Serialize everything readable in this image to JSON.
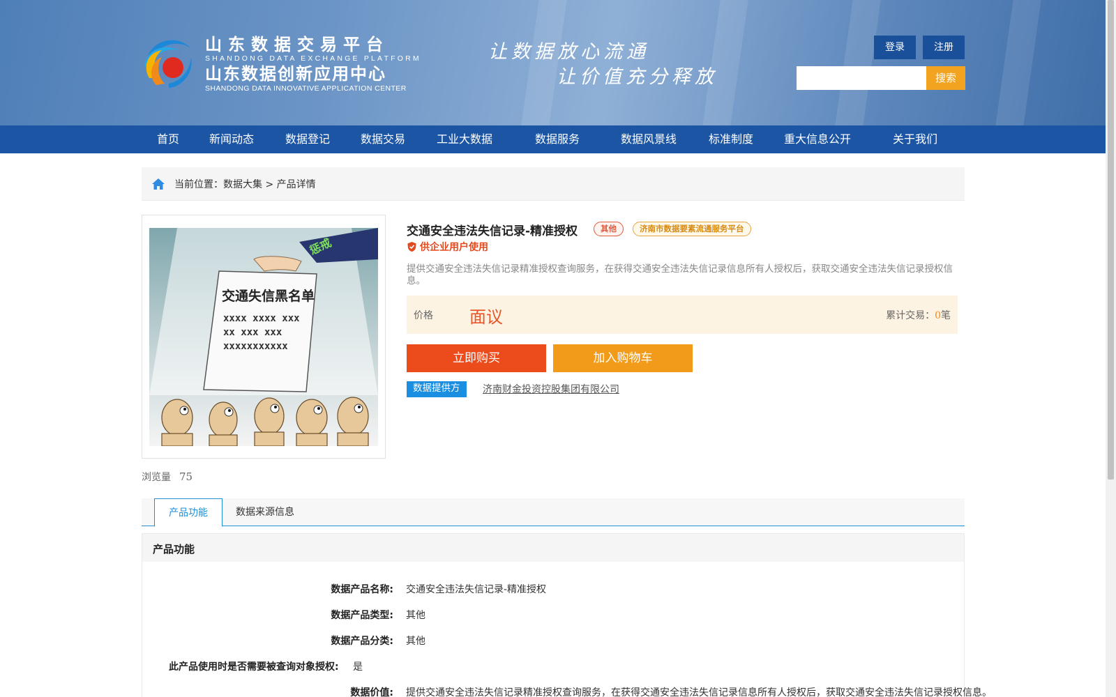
{
  "header": {
    "logo": {
      "cn_line1": "山东数据交易平台",
      "en_line1": "SHANDONG DATA EXCHANGE PLATFORM",
      "cn_line2": "山东数据创新应用中心",
      "en_line2": "SHANDONG DATA INNOVATIVE APPLICATION CENTER"
    },
    "slogan_line1": "让数据放心流通",
    "slogan_line2": "让价值充分释放",
    "login_label": "登录",
    "register_label": "注册",
    "search_placeholder": "",
    "search_label": "搜索"
  },
  "nav": {
    "items": [
      "首页",
      "新闻动态",
      "数据登记",
      "数据交易",
      "工业大数据",
      "数据服务",
      "数据风景线",
      "标准制度",
      "重大信息公开",
      "关于我们"
    ]
  },
  "breadcrumb": {
    "prefix": "当前位置：",
    "level1": "数据大集",
    "separator": " > ",
    "level2": "产品详情"
  },
  "product": {
    "image_text": {
      "sleeve_label": "惩戒",
      "paper_title": "交通失信黑名单",
      "paper_line1": "xxxx xxxx xxx",
      "paper_line2": "xx xxx xxx",
      "paper_line3": "xxxxxxxxxxx"
    },
    "views_label": "浏览量",
    "views_count": "75",
    "title": "交通安全违法失信记录-精准授权",
    "tag_category": "其他",
    "tag_platform": "济南市数据要素流通服务平台",
    "enterprise_label": "供企业用户使用",
    "description": "提供交通安全违法失信记录精准授权查询服务，在获得交通安全违法失信记录信息所有人授权后，获取交通安全违法失信记录授权信息。",
    "price_label": "价格",
    "price_value": "面议",
    "deals_label": "累计交易：",
    "deals_count": "0",
    "deals_unit": "笔",
    "buy_label": "立即购买",
    "cart_label": "加入购物车",
    "provider_label": "数据提供方",
    "provider_name": "济南财金投资控股集团有限公司"
  },
  "tabs": [
    "产品功能",
    "数据来源信息"
  ],
  "section": {
    "title": "产品功能",
    "rows": [
      {
        "k": "数据产品名称:",
        "v": "交通安全违法失信记录-精准授权"
      },
      {
        "k": "数据产品类型:",
        "v": "其他"
      },
      {
        "k": "数据产品分类:",
        "v": "其他"
      },
      {
        "k": "此产品使用时是否需要被查询对象授权:",
        "v": "是"
      },
      {
        "k": "数据价值:",
        "v": "提供交通安全违法失信记录精准授权查询服务，在获得交通安全违法失信记录信息所有人授权后，获取交通安全违法失信记录授权信息。"
      }
    ]
  },
  "colors": {
    "nav_bg": "#1b55a4",
    "accent_orange": "#f29b1a",
    "buy_red": "#ec4b1c",
    "tab_blue": "#1f8fd6"
  }
}
